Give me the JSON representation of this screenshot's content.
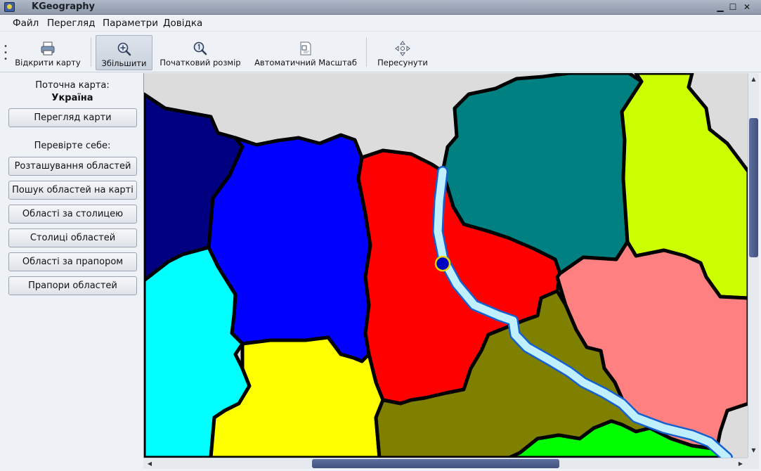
{
  "window": {
    "title": "KGeography",
    "minimize_glyph": "▁",
    "maximize_glyph": "☐",
    "close_glyph": "✕"
  },
  "menu": [
    "Файл",
    "Перегляд",
    "Параметри",
    "Довідка"
  ],
  "toolbar": {
    "open_map": "Відкрити карту",
    "zoom": "Збільшити",
    "original_size": "Початковий розмір",
    "auto_zoom": "Автоматичний Масштаб",
    "move": "Пересунути"
  },
  "sidebar": {
    "current_map_label": "Поточна карта:",
    "current_map_name": "Україна",
    "browse_button": "Перегляд карти",
    "test_label": "Перевірте себе:",
    "quiz_buttons": [
      "Розташування областей",
      "Пошук областей на карті",
      "Області за столицею",
      "Столиці областей",
      "Області за прапором",
      "Прапори областей"
    ]
  },
  "map": {
    "colors": {
      "background": "#dcdcdc",
      "navy_region": "#000080",
      "blue_region": "#0000ff",
      "teal_region": "#008080",
      "yellowgreen_region": "#ccff00",
      "red_region": "#ff0000",
      "cyan_region": "#00ffff",
      "yellow_region": "#ffff00",
      "olive_region": "#808000",
      "salmon_region": "#ff8080",
      "green_region": "#00ff00",
      "river": "#c0f0ff",
      "capital_marker": "#0000c0"
    }
  },
  "scrollbars": {
    "up": "▲",
    "down": "▼",
    "left": "◀",
    "right": "▶"
  }
}
